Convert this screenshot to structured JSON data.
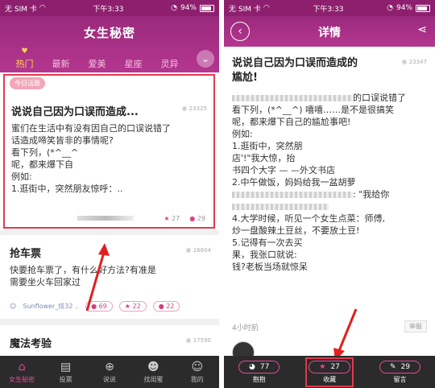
{
  "left": {
    "status": {
      "carrier": "无 SIM 卡",
      "time": "下午3:33",
      "battery": "94%"
    },
    "title": "女生秘密",
    "tabs": [
      "热门",
      "最新",
      "爱美",
      "星座",
      "灵异"
    ],
    "card1": {
      "badge": "今日话题",
      "title": "说说自己因为口误而造成...",
      "views": "23325",
      "body": [
        "蜜们在生活中有没有因自己的口误说错了",
        "话造成啼笑皆非的事情呢?",
        "看下列，(*^__^",
        "呢，都来爆下自",
        "例如:",
        "1.逛街中，突然朋友惊呼：.."
      ],
      "stars": "27",
      "comments": "29"
    },
    "card2": {
      "title": "抢车票",
      "views": "16604",
      "body": [
        "快要抢车票了，有什么好方法?有准是",
        "需要坐火车回家过"
      ],
      "user": "Sunflower_炫32 ..",
      "likes": "69",
      "stars": "22",
      "comments": "22"
    },
    "card3": {
      "title": "魔法考验",
      "views": "17590"
    },
    "nav": [
      "女生秘密",
      "投票",
      "说说",
      "找闺蜜",
      "我的"
    ]
  },
  "right": {
    "status": {
      "carrier": "无 SIM 卡",
      "time": "下午3:33",
      "battery": "94%"
    },
    "title": "详情",
    "detail_title": [
      "说说自己因为口误而造成的",
      "尴尬!"
    ],
    "views": "23347",
    "body": [
      "的口误说错了",
      "看下列，(*^__^) 嘻嘻……是不是很搞笑",
      "呢，都来爆下自己的尴尬事吧!",
      "例如:",
      "1.逛街中，突然朋",
      "店'!\"我大惊，抬",
      "书四个大字 — —外文书店",
      "2.中午做饭，妈妈给我一盆胡萝",
      ": \"我给你",
      "4.大学时候，听见一个女生点菜：师傅,",
      "炒一盘酸辣土豆丝，不要放土豆!",
      "5.记得有一次去买",
      "果，我张口就说:",
      "钱?老板当场就惊呆"
    ],
    "time_ago": "4小时前",
    "report": "举报",
    "actions": [
      {
        "label": "抱抱",
        "count": "77"
      },
      {
        "label": "收藏",
        "count": "27"
      },
      {
        "label": "留言",
        "count": "29"
      }
    ]
  }
}
